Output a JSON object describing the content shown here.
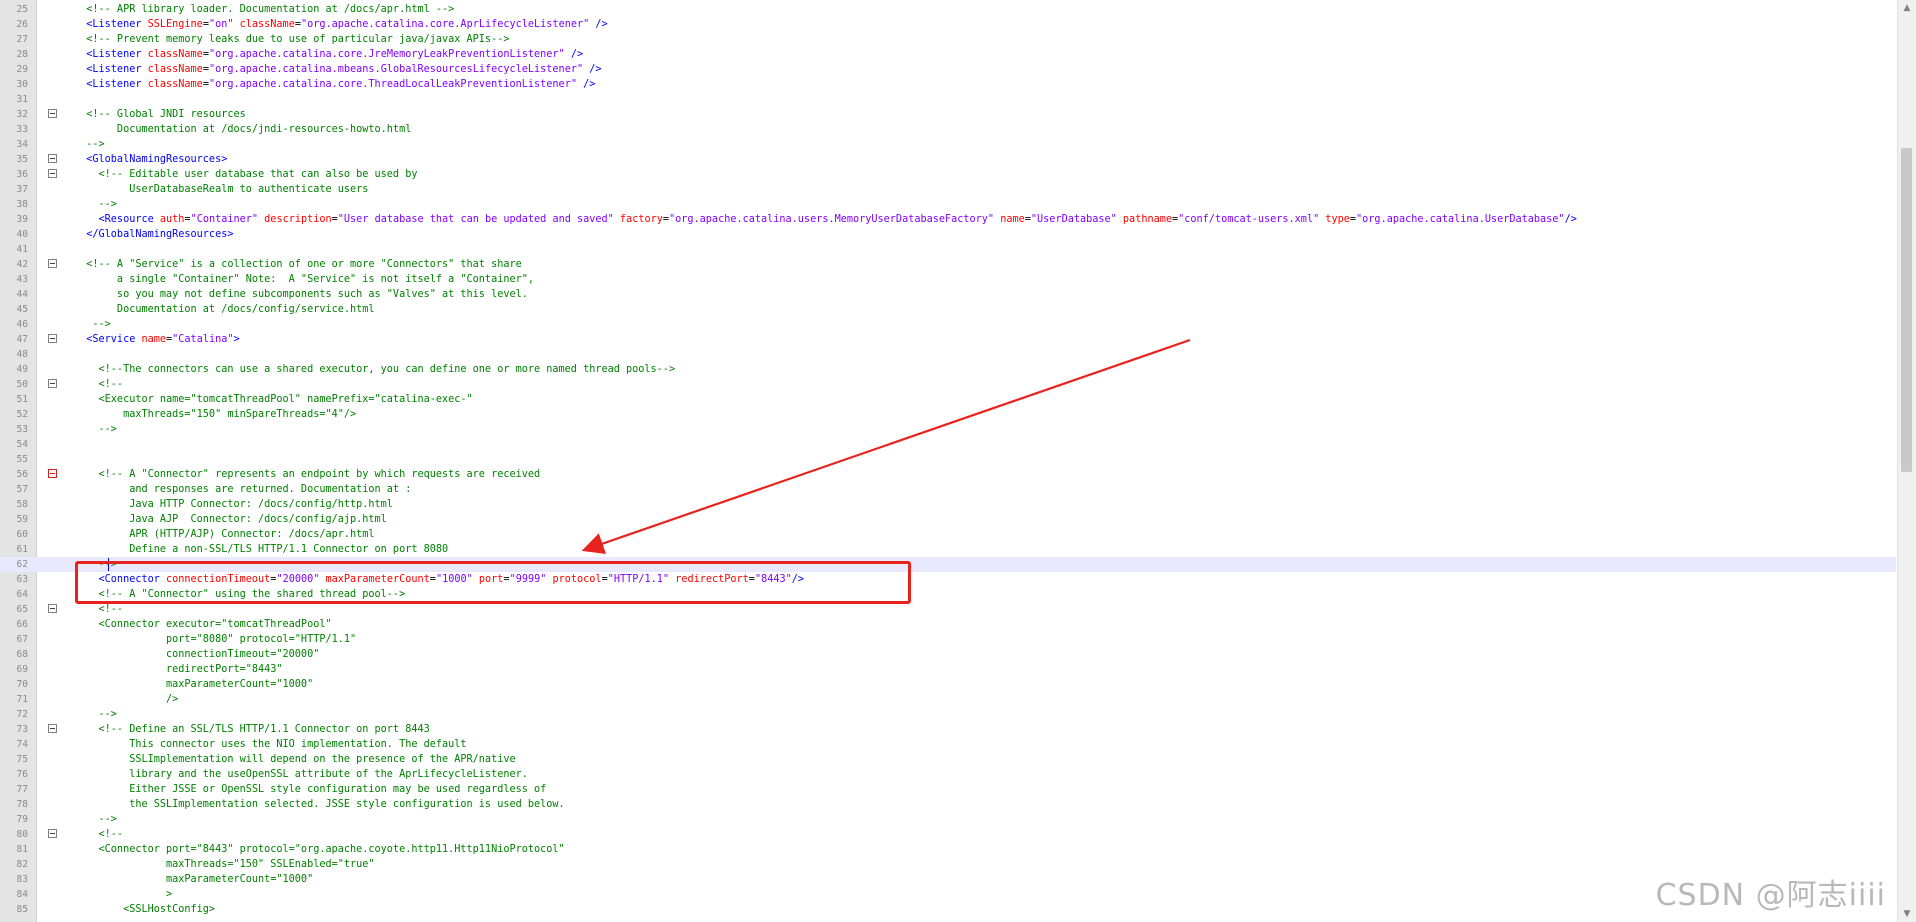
{
  "editor": {
    "lines": [
      {
        "n": "25",
        "fold": "",
        "segs": [
          [
            "cm",
            "  <!-- APR library loader. Documentation at /docs/apr.html -->"
          ]
        ]
      },
      {
        "n": "26",
        "fold": "",
        "segs": [
          [
            "tg",
            "  <Listener "
          ],
          [
            "at",
            "SSLEngine"
          ],
          [
            "eq",
            "="
          ],
          [
            "st",
            "\"on\" "
          ],
          [
            "at",
            "className"
          ],
          [
            "eq",
            "="
          ],
          [
            "st",
            "\"org.apache.catalina.core.AprLifecycleListener\""
          ],
          [
            "tg",
            " />"
          ]
        ]
      },
      {
        "n": "27",
        "fold": "",
        "segs": [
          [
            "cm",
            "  <!-- Prevent memory leaks due to use of particular java/javax APIs-->"
          ]
        ]
      },
      {
        "n": "28",
        "fold": "",
        "segs": [
          [
            "tg",
            "  <Listener "
          ],
          [
            "at",
            "className"
          ],
          [
            "eq",
            "="
          ],
          [
            "st",
            "\"org.apache.catalina.core.JreMemoryLeakPreventionListener\""
          ],
          [
            "tg",
            " />"
          ]
        ]
      },
      {
        "n": "29",
        "fold": "",
        "segs": [
          [
            "tg",
            "  <Listener "
          ],
          [
            "at",
            "className"
          ],
          [
            "eq",
            "="
          ],
          [
            "st",
            "\"org.apache.catalina.mbeans.GlobalResourcesLifecycleListener\""
          ],
          [
            "tg",
            " />"
          ]
        ]
      },
      {
        "n": "30",
        "fold": "",
        "segs": [
          [
            "tg",
            "  <Listener "
          ],
          [
            "at",
            "className"
          ],
          [
            "eq",
            "="
          ],
          [
            "st",
            "\"org.apache.catalina.core.ThreadLocalLeakPreventionListener\""
          ],
          [
            "tg",
            " />"
          ]
        ]
      },
      {
        "n": "31",
        "fold": "",
        "segs": []
      },
      {
        "n": "32",
        "fold": "box",
        "segs": [
          [
            "cm",
            "  <!-- Global JNDI resources"
          ]
        ]
      },
      {
        "n": "33",
        "fold": "",
        "segs": [
          [
            "cm",
            "       Documentation at /docs/jndi-resources-howto.html"
          ]
        ]
      },
      {
        "n": "34",
        "fold": "",
        "segs": [
          [
            "cm",
            "  -->"
          ]
        ]
      },
      {
        "n": "35",
        "fold": "box",
        "segs": [
          [
            "tg",
            "  <GlobalNamingResources>"
          ]
        ]
      },
      {
        "n": "36",
        "fold": "box",
        "segs": [
          [
            "cm",
            "    <!-- Editable user database that can also be used by"
          ]
        ]
      },
      {
        "n": "37",
        "fold": "",
        "segs": [
          [
            "cm",
            "         UserDatabaseRealm to authenticate users"
          ]
        ]
      },
      {
        "n": "38",
        "fold": "",
        "segs": [
          [
            "cm",
            "    -->"
          ]
        ]
      },
      {
        "n": "39",
        "fold": "",
        "segs": [
          [
            "tg",
            "    <Resource "
          ],
          [
            "at",
            "auth"
          ],
          [
            "eq",
            "="
          ],
          [
            "st",
            "\"Container\" "
          ],
          [
            "at",
            "description"
          ],
          [
            "eq",
            "="
          ],
          [
            "st",
            "\"User database that can be updated and saved\" "
          ],
          [
            "at",
            "factory"
          ],
          [
            "eq",
            "="
          ],
          [
            "st",
            "\"org.apache.catalina.users.MemoryUserDatabaseFactory\" "
          ],
          [
            "at",
            "name"
          ],
          [
            "eq",
            "="
          ],
          [
            "st",
            "\"UserDatabase\" "
          ],
          [
            "at",
            "pathname"
          ],
          [
            "eq",
            "="
          ],
          [
            "st",
            "\"conf/tomcat-users.xml\" "
          ],
          [
            "at",
            "type"
          ],
          [
            "eq",
            "="
          ],
          [
            "st",
            "\"org.apache.catalina.UserDatabase\""
          ],
          [
            "tg",
            "/>"
          ]
        ]
      },
      {
        "n": "40",
        "fold": "",
        "segs": [
          [
            "tg",
            "  </GlobalNamingResources>"
          ]
        ]
      },
      {
        "n": "41",
        "fold": "",
        "segs": []
      },
      {
        "n": "42",
        "fold": "box",
        "segs": [
          [
            "cm",
            "  <!-- A \"Service\" is a collection of one or more \"Connectors\" that share"
          ]
        ]
      },
      {
        "n": "43",
        "fold": "",
        "segs": [
          [
            "cm",
            "       a single \"Container\" Note:  A \"Service\" is not itself a \"Container\","
          ]
        ]
      },
      {
        "n": "44",
        "fold": "",
        "segs": [
          [
            "cm",
            "       so you may not define subcomponents such as \"Valves\" at this level."
          ]
        ]
      },
      {
        "n": "45",
        "fold": "",
        "segs": [
          [
            "cm",
            "       Documentation at /docs/config/service.html"
          ]
        ]
      },
      {
        "n": "46",
        "fold": "",
        "segs": [
          [
            "cm",
            "   -->"
          ]
        ]
      },
      {
        "n": "47",
        "fold": "box",
        "segs": [
          [
            "tg",
            "  <Service "
          ],
          [
            "at",
            "name"
          ],
          [
            "eq",
            "="
          ],
          [
            "st",
            "\"Catalina\""
          ],
          [
            "tg",
            ">"
          ]
        ]
      },
      {
        "n": "48",
        "fold": "",
        "segs": []
      },
      {
        "n": "49",
        "fold": "",
        "segs": [
          [
            "cm",
            "    <!--The connectors can use a shared executor, you can define one or more named thread pools-->"
          ]
        ]
      },
      {
        "n": "50",
        "fold": "box",
        "segs": [
          [
            "cm",
            "    <!--"
          ]
        ]
      },
      {
        "n": "51",
        "fold": "",
        "segs": [
          [
            "cm",
            "    <Executor name=\"tomcatThreadPool\" namePrefix=\"catalina-exec-\""
          ]
        ]
      },
      {
        "n": "52",
        "fold": "",
        "segs": [
          [
            "cm",
            "        maxThreads=\"150\" minSpareThreads=\"4\"/>"
          ]
        ]
      },
      {
        "n": "53",
        "fold": "",
        "segs": [
          [
            "cm",
            "    -->"
          ]
        ]
      },
      {
        "n": "54",
        "fold": "",
        "segs": []
      },
      {
        "n": "55",
        "fold": "",
        "segs": []
      },
      {
        "n": "56",
        "fold": "red",
        "segs": [
          [
            "cm",
            "    <!-- A \"Connector\" represents an endpoint by which requests are received"
          ]
        ]
      },
      {
        "n": "57",
        "fold": "",
        "segs": [
          [
            "cm",
            "         and responses are returned. Documentation at :"
          ]
        ]
      },
      {
        "n": "58",
        "fold": "",
        "segs": [
          [
            "cm",
            "         Java HTTP Connector: /docs/config/http.html"
          ]
        ]
      },
      {
        "n": "59",
        "fold": "",
        "segs": [
          [
            "cm",
            "         Java AJP  Connector: /docs/config/ajp.html"
          ]
        ]
      },
      {
        "n": "60",
        "fold": "",
        "segs": [
          [
            "cm",
            "         APR (HTTP/AJP) Connector: /docs/apr.html"
          ]
        ]
      },
      {
        "n": "61",
        "fold": "",
        "segs": [
          [
            "cm",
            "         Define a non-SSL/TLS HTTP/1.1 Connector on port 8080"
          ]
        ]
      },
      {
        "n": "62",
        "fold": "",
        "current": true,
        "segs": [
          [
            "cm",
            "    -->"
          ]
        ]
      },
      {
        "n": "63",
        "fold": "",
        "segs": [
          [
            "tg",
            "    <Connector "
          ],
          [
            "at",
            "connectionTimeout"
          ],
          [
            "eq",
            "="
          ],
          [
            "st",
            "\"20000\" "
          ],
          [
            "at",
            "maxParameterCount"
          ],
          [
            "eq",
            "="
          ],
          [
            "st",
            "\"1000\" "
          ],
          [
            "at",
            "port"
          ],
          [
            "eq",
            "="
          ],
          [
            "st",
            "\"9999\" "
          ],
          [
            "at",
            "protocol"
          ],
          [
            "eq",
            "="
          ],
          [
            "st",
            "\"HTTP/1.1\" "
          ],
          [
            "at",
            "redirectPort"
          ],
          [
            "eq",
            "="
          ],
          [
            "st",
            "\"8443\""
          ],
          [
            "tg",
            "/>"
          ]
        ]
      },
      {
        "n": "64",
        "fold": "",
        "segs": [
          [
            "cm",
            "    <!-- A \"Connector\" using the shared thread pool-->"
          ]
        ]
      },
      {
        "n": "65",
        "fold": "box",
        "segs": [
          [
            "cm",
            "    <!--"
          ]
        ]
      },
      {
        "n": "66",
        "fold": "",
        "segs": [
          [
            "cm",
            "    <Connector executor=\"tomcatThreadPool\""
          ]
        ]
      },
      {
        "n": "67",
        "fold": "",
        "segs": [
          [
            "cm",
            "               port=\"8080\" protocol=\"HTTP/1.1\""
          ]
        ]
      },
      {
        "n": "68",
        "fold": "",
        "segs": [
          [
            "cm",
            "               connectionTimeout=\"20000\""
          ]
        ]
      },
      {
        "n": "69",
        "fold": "",
        "segs": [
          [
            "cm",
            "               redirectPort=\"8443\""
          ]
        ]
      },
      {
        "n": "70",
        "fold": "",
        "segs": [
          [
            "cm",
            "               maxParameterCount=\"1000\""
          ]
        ]
      },
      {
        "n": "71",
        "fold": "",
        "segs": [
          [
            "cm",
            "               />"
          ]
        ]
      },
      {
        "n": "72",
        "fold": "",
        "segs": [
          [
            "cm",
            "    -->"
          ]
        ]
      },
      {
        "n": "73",
        "fold": "box",
        "segs": [
          [
            "cm",
            "    <!-- Define an SSL/TLS HTTP/1.1 Connector on port 8443"
          ]
        ]
      },
      {
        "n": "74",
        "fold": "",
        "segs": [
          [
            "cm",
            "         This connector uses the NIO implementation. The default"
          ]
        ]
      },
      {
        "n": "75",
        "fold": "",
        "segs": [
          [
            "cm",
            "         SSLImplementation will depend on the presence of the APR/native"
          ]
        ]
      },
      {
        "n": "76",
        "fold": "",
        "segs": [
          [
            "cm",
            "         library and the useOpenSSL attribute of the AprLifecycleListener."
          ]
        ]
      },
      {
        "n": "77",
        "fold": "",
        "segs": [
          [
            "cm",
            "         Either JSSE or OpenSSL style configuration may be used regardless of"
          ]
        ]
      },
      {
        "n": "78",
        "fold": "",
        "segs": [
          [
            "cm",
            "         the SSLImplementation selected. JSSE style configuration is used below."
          ]
        ]
      },
      {
        "n": "79",
        "fold": "",
        "segs": [
          [
            "cm",
            "    -->"
          ]
        ]
      },
      {
        "n": "80",
        "fold": "box",
        "segs": [
          [
            "cm",
            "    <!--"
          ]
        ]
      },
      {
        "n": "81",
        "fold": "",
        "segs": [
          [
            "cm",
            "    <Connector port=\"8443\" protocol=\"org.apache.coyote.http11.Http11NioProtocol\""
          ]
        ]
      },
      {
        "n": "82",
        "fold": "",
        "segs": [
          [
            "cm",
            "               maxThreads=\"150\" SSLEnabled=\"true\""
          ]
        ]
      },
      {
        "n": "83",
        "fold": "",
        "segs": [
          [
            "cm",
            "               maxParameterCount=\"1000\""
          ]
        ]
      },
      {
        "n": "84",
        "fold": "",
        "segs": [
          [
            "cm",
            "               >"
          ]
        ]
      },
      {
        "n": "85",
        "fold": "",
        "segs": [
          [
            "cm",
            "        <SSLHostConfig>"
          ]
        ]
      }
    ]
  },
  "watermark": "CSDN @阿志iiii",
  "colors": {
    "comment": "#008000",
    "tag": "#0000ff",
    "attribute": "#ff0000",
    "string": "#8000ff",
    "annotation": "#e8231e"
  }
}
